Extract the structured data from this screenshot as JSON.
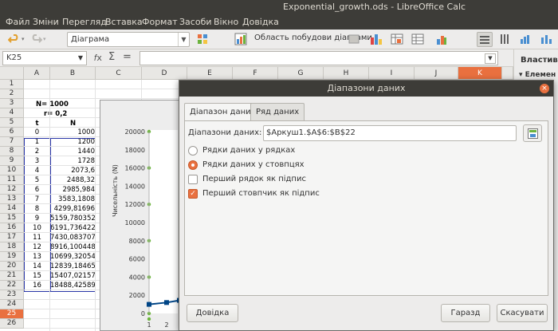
{
  "window": {
    "title": "Exponential_growth.ods - LibreOffice Calc"
  },
  "menu": [
    "Файл",
    "Зміни",
    "Перегляд",
    "Вставка",
    "Формат",
    "Засоби",
    "Вікно",
    "Довідка"
  ],
  "toolbar": {
    "chart_combo": "Діаграма",
    "chart_area_label": "Область побудови діаграми"
  },
  "formula": {
    "cell_ref": "K25",
    "value": ""
  },
  "sidebar": {
    "title": "Властив",
    "section": "Елемен"
  },
  "sheet": {
    "columns": [
      "A",
      "B",
      "C",
      "D",
      "E",
      "F",
      "G",
      "H",
      "I",
      "J",
      "K"
    ],
    "active_column": "K",
    "rows": [
      "1",
      "2",
      "3",
      "4",
      "5",
      "6",
      "7",
      "8",
      "9",
      "10",
      "11",
      "12",
      "13",
      "14",
      "15",
      "16",
      "17",
      "18",
      "19",
      "20",
      "21",
      "22",
      "23",
      "24",
      "25",
      "26"
    ],
    "active_row": "25",
    "params": {
      "n0_label": "N= 1000",
      "r_label": "r= 0,2"
    },
    "headers": {
      "t": "t",
      "n": "N"
    },
    "t_values": [
      "0",
      "1",
      "2",
      "3",
      "4",
      "5",
      "6",
      "7",
      "8",
      "9",
      "10",
      "11",
      "12",
      "13",
      "14",
      "15",
      "16"
    ],
    "n_values": [
      "1000",
      "1200",
      "1440",
      "1728",
      "2073,6",
      "2488,32",
      "2985,984",
      "3583,1808",
      "4299,81696",
      "5159,780352",
      "6191,736422",
      "7430,083707",
      "8916,100448",
      "10699,32054",
      "12839,18465",
      "15407,02157",
      "18488,42589"
    ]
  },
  "chart": {
    "y_ticks": [
      "20000",
      "18000",
      "16000",
      "14000",
      "12000",
      "10000",
      "8000",
      "6000",
      "4000",
      "2000",
      "0"
    ],
    "x_ticks": [
      "1",
      "2"
    ],
    "ylabel": "Чисельність (N)",
    "series_color": "#004586"
  },
  "dialog": {
    "title": "Діапазони даних",
    "tabs": [
      "Діапазон даних",
      "Ряд даних"
    ],
    "range_label": "Діапазони даних:",
    "range_value": "$Аркуш1.$A$6:$B$22",
    "options": {
      "rows_label": "Рядки даних у рядках",
      "cols_label": "Рядки даних у стовпцях",
      "first_row_label": "Перший рядок як підпис",
      "first_col_label": "Перший стовпчик як підпис"
    },
    "buttons": {
      "help": "Довідка",
      "ok": "Гаразд",
      "cancel": "Скасувати"
    }
  }
}
